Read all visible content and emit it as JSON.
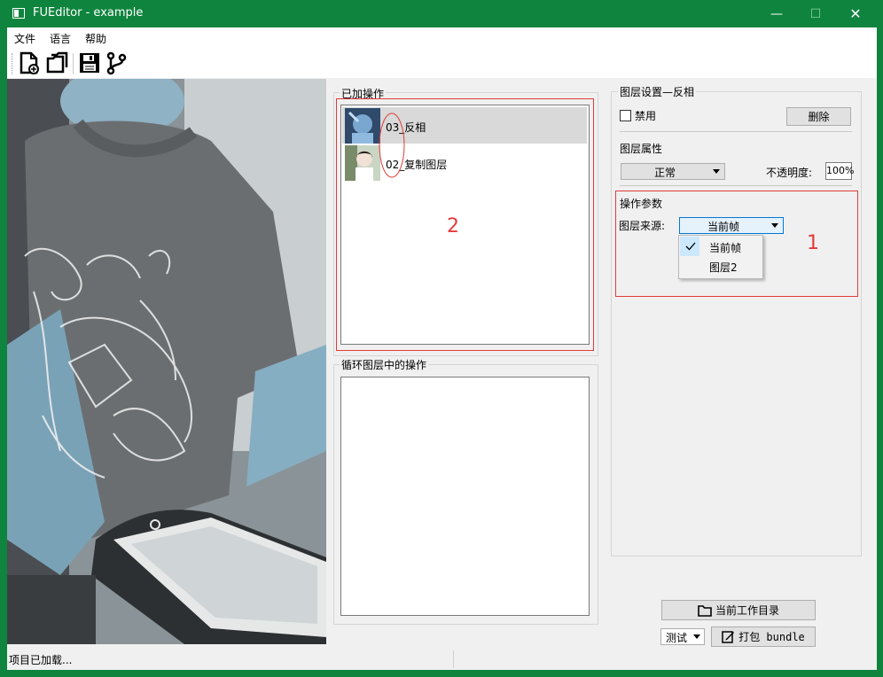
{
  "window": {
    "title": "FUEditor - example"
  },
  "titlebar": {
    "minimize": "—",
    "maximize": "☐",
    "close": "✕"
  },
  "menu": {
    "file": "文件",
    "language": "语言",
    "help": "帮助"
  },
  "toolbar": {
    "icons": [
      "new-file-icon",
      "open-folder-icon",
      "save-icon",
      "branch-icon"
    ]
  },
  "ops": {
    "title": "已加操作",
    "items": [
      {
        "label": "03_反相",
        "selected": true
      },
      {
        "label": "02_复制图层",
        "selected": false
      }
    ],
    "annotation": "2"
  },
  "loop_ops": {
    "title": "循环图层中的操作"
  },
  "layer": {
    "settings_title": "图层设置—反相",
    "disable_label": "禁用",
    "delete_label": "删除",
    "props_title": "图层属性",
    "blend_mode": "正常",
    "opacity_label": "不透明度:",
    "opacity_value": "100%",
    "params_title": "操作参数",
    "source_label": "图层来源:",
    "source_value": "当前帧",
    "source_options": [
      {
        "label": "当前帧",
        "checked": true
      },
      {
        "label": "图层2",
        "checked": false
      }
    ],
    "annotation": "1"
  },
  "bottom": {
    "workdir_label": "当前工作目录",
    "mode_value": "测试",
    "pack_label": "打包 bundle"
  },
  "status": {
    "text": "项目已加载..."
  },
  "colors": {
    "titlebar": "#0f843e",
    "selected_row": "#d9d9d9",
    "annotation_red": "#e23b3b",
    "dropdown_highlight": "#cce8ff"
  }
}
